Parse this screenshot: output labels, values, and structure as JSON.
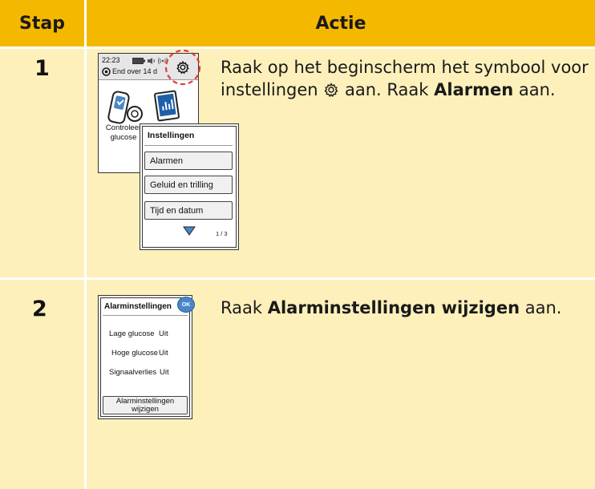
{
  "header": {
    "col_step": "Stap",
    "col_action": "Actie"
  },
  "colors": {
    "header_bg": "#f5b800",
    "cell_bg": "#fdf0bb",
    "alert_dash": "#e03a3a",
    "ok_badge": "#4a86c8"
  },
  "rows": [
    {
      "step": "1",
      "text_pre": "Raak op het beginscherm het symbool voor instellingen",
      "text_icon": "gear-icon",
      "text_mid": "aan. Raak",
      "text_bold": "Alarmen",
      "text_post": "aan.",
      "home_screen": {
        "time": "22:23",
        "sensor_status": "End over 14 d",
        "tile_label_1": "Controleer",
        "tile_label_2": "glucose"
      },
      "settings_menu": {
        "title": "Instellingen",
        "items": [
          "Alarmen",
          "Geluid en trilling",
          "Tijd en datum"
        ],
        "page": "1 / 3"
      }
    },
    {
      "step": "2",
      "text_pre": "Raak",
      "text_bold": "Alarminstellingen wijzigen",
      "text_post": "aan.",
      "alarm_screen": {
        "title": "Alarminstellingen",
        "ok": "OK",
        "rows": [
          {
            "label": "Lage glucose",
            "value": "Uit"
          },
          {
            "label": "Hoge glucose",
            "value": "Uit"
          },
          {
            "label": "Signaalverlies",
            "value": "Uit"
          }
        ],
        "button_line1": "Alarminstellingen",
        "button_line2": "wijzigen"
      }
    }
  ]
}
